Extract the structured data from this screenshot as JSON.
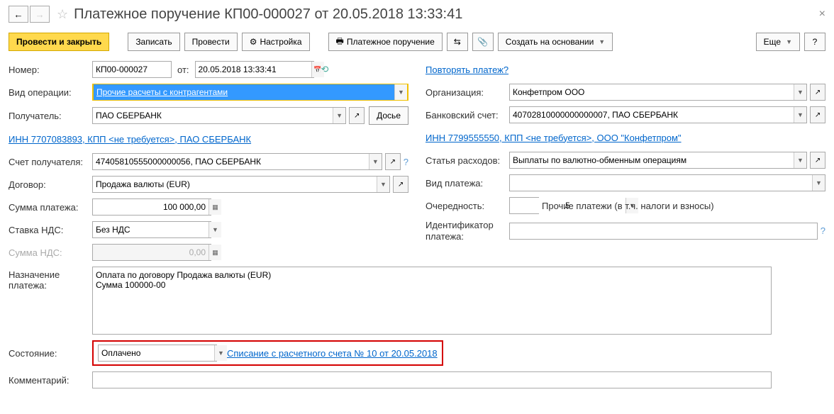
{
  "header": {
    "title": "Платежное поручение КП00-000027 от 20.05.2018 13:33:41"
  },
  "toolbar": {
    "post_close": "Провести и закрыть",
    "save": "Записать",
    "post": "Провести",
    "settings": "Настройка",
    "print": "Платежное поручение",
    "create_based": "Создать на основании",
    "more": "Еще"
  },
  "labels": {
    "number": "Номер:",
    "from": "от:",
    "operation_type": "Вид операции:",
    "recipient": "Получатель:",
    "recipient_account": "Счет получателя:",
    "contract": "Договор:",
    "payment_sum": "Сумма платежа:",
    "vat_rate": "Ставка НДС:",
    "vat_sum": "Сумма НДС:",
    "purpose": "Назначение платежа:",
    "state": "Состояние:",
    "comment": "Комментарий:",
    "repeat": "Повторять платеж?",
    "organization": "Организация:",
    "bank_account": "Банковский счет:",
    "expense_item": "Статья расходов:",
    "payment_type": "Вид платежа:",
    "priority": "Очередность:",
    "payment_id": "Идентификатор платежа:",
    "dossier": "Досье"
  },
  "values": {
    "number": "КП00-000027",
    "date": "20.05.2018 13:33:41",
    "operation_type": "Прочие расчеты с контрагентами",
    "recipient": "ПАО СБЕРБАНК",
    "recipient_link": "ИНН 7707083893, КПП <не требуется>, ПАО СБЕРБАНК",
    "recipient_account": "47405810555000000056, ПАО СБЕРБАНК",
    "contract": "Продажа валюты (EUR)",
    "payment_sum": "100 000,00",
    "vat_rate": "Без НДС",
    "vat_sum": "0,00",
    "purpose": "Оплата по договору Продажа валюты (EUR)\nСумма 100000-00",
    "state": "Оплачено",
    "state_link": "Списание с расчетного счета № 10 от 20.05.2018",
    "organization": "Конфетпром ООО",
    "bank_account": "40702810000000000007, ПАО СБЕРБАНК",
    "org_link": "ИНН 7799555550, КПП <не требуется>, ООО \"Конфетпром\"",
    "expense_item": "Выплаты по валютно-обменным операциям",
    "priority": "5",
    "priority_text": "Прочие платежи (в т.ч. налоги и взносы)"
  }
}
